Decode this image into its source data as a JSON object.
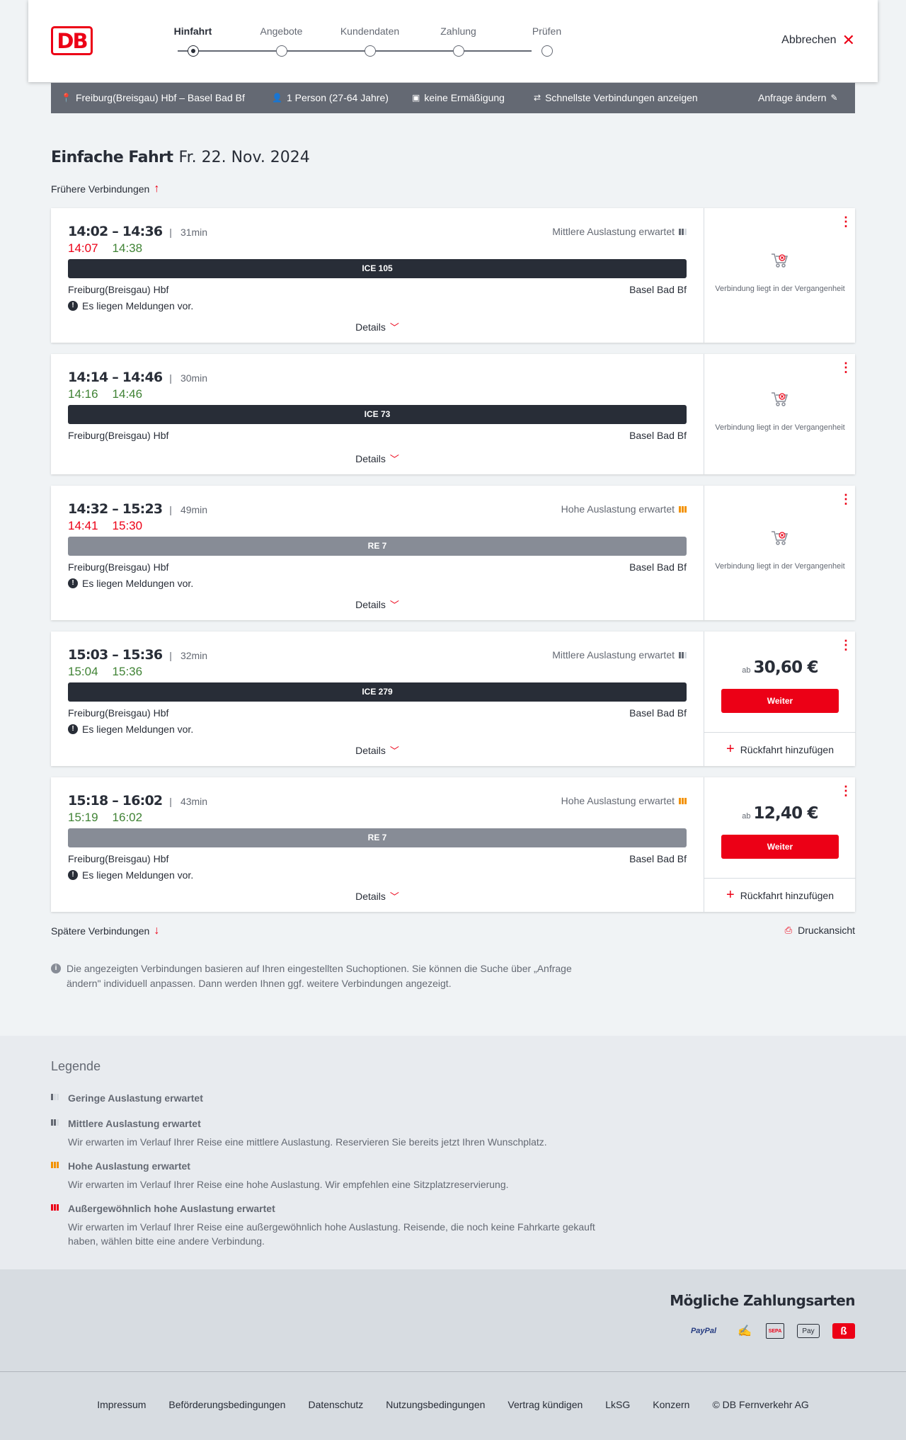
{
  "header": {
    "logo_text": "DB",
    "steps": [
      {
        "label": "Hinfahrt"
      },
      {
        "label": "Angebote"
      },
      {
        "label": "Kundendaten"
      },
      {
        "label": "Zahlung"
      },
      {
        "label": "Prüfen"
      }
    ],
    "cancel_label": "Abbrechen"
  },
  "searchbar": {
    "route": "Freiburg(Breisgau) Hbf – Basel Bad Bf",
    "persons": "1 Person (27-64 Jahre)",
    "discount": "keine Ermäßigung",
    "fastest": "Schnellste Verbindungen anzeigen",
    "change": "Anfrage ändern"
  },
  "title": {
    "main": "Einfache Fahrt",
    "date": "Fr. 22. Nov. 2024"
  },
  "earlier_label": "Frühere Verbindungen",
  "later_label": "Spätere Verbindungen",
  "print_label": "Druckansicht",
  "connections": [
    {
      "times": "14:02 – 14:36",
      "duration": "31min",
      "rt_dep": "14:07",
      "rt_arr": "14:38",
      "occupancy": "Mittlere Auslastung erwartet",
      "train": "ICE 105",
      "from": "Freiburg(Breisgau) Hbf",
      "to": "Basel Bad Bf",
      "message": "Es liegen Meldungen vor.",
      "details": "Details",
      "past": "Verbindung liegt in der Vergangenheit"
    },
    {
      "times": "14:14 – 14:46",
      "duration": "30min",
      "rt_dep": "14:16",
      "rt_arr": "14:46",
      "train": "ICE 73",
      "from": "Freiburg(Breisgau) Hbf",
      "to": "Basel Bad Bf",
      "details": "Details",
      "past": "Verbindung liegt in der Vergangenheit"
    },
    {
      "times": "14:32 – 15:23",
      "duration": "49min",
      "rt_dep": "14:41",
      "rt_arr": "15:30",
      "occupancy": "Hohe Auslastung erwartet",
      "train": "RE 7",
      "from": "Freiburg(Breisgau) Hbf",
      "to": "Basel Bad Bf",
      "message": "Es liegen Meldungen vor.",
      "details": "Details",
      "past": "Verbindung liegt in der Vergangenheit"
    },
    {
      "times": "15:03 – 15:36",
      "duration": "32min",
      "rt_dep": "15:04",
      "rt_arr": "15:36",
      "occupancy": "Mittlere Auslastung erwartet",
      "train": "ICE 279",
      "from": "Freiburg(Breisgau) Hbf",
      "to": "Basel Bad Bf",
      "message": "Es liegen Meldungen vor.",
      "details": "Details",
      "price_prefix": "ab",
      "price": "30,60 €",
      "weiter": "Weiter",
      "return": "Rückfahrt hinzufügen"
    },
    {
      "times": "15:18 – 16:02",
      "duration": "43min",
      "rt_dep": "15:19",
      "rt_arr": "16:02",
      "occupancy": "Hohe Auslastung erwartet",
      "train": "RE 7",
      "from": "Freiburg(Breisgau) Hbf",
      "to": "Basel Bad Bf",
      "message": "Es liegen Meldungen vor.",
      "details": "Details",
      "price_prefix": "ab",
      "price": "12,40 €",
      "weiter": "Weiter",
      "return": "Rückfahrt hinzufügen"
    }
  ],
  "info_text": "Die angezeigten Verbindungen basieren auf Ihren eingestellten Suchoptionen. Sie können die Suche über „Anfrage ändern\" individuell anpassen. Dann werden Ihnen ggf. weitere Verbindungen angezeigt.",
  "legend": {
    "title": "Legende",
    "items": [
      {
        "title": "Geringe Auslastung erwartet",
        "desc": ""
      },
      {
        "title": "Mittlere Auslastung erwartet",
        "desc": "Wir erwarten im Verlauf Ihrer Reise eine mittlere Auslastung. Reservieren Sie bereits jetzt Ihren Wunschplatz."
      },
      {
        "title": "Hohe Auslastung erwartet",
        "desc": "Wir erwarten im Verlauf Ihrer Reise eine hohe Auslastung. Wir empfehlen eine Sitzplatzreservierung."
      },
      {
        "title": "Außergewöhnlich hohe Auslastung erwartet",
        "desc": "Wir erwarten im Verlauf Ihrer Reise eine außergewöhnlich hohe Auslastung. Reisende, die noch keine Fahrkarte gekauft haben, wählen bitte eine andere Verbindung."
      }
    ]
  },
  "payments": {
    "title": "Mögliche Zahlungsarten",
    "paypal": "PayPal",
    "sepa": "SEPA",
    "applepay": "Pay"
  },
  "footer": [
    "Impressum",
    "Beförderungsbedingungen",
    "Datenschutz",
    "Nutzungsbedingungen",
    "Vertrag kündigen",
    "LkSG",
    "Konzern",
    "© DB Fernverkehr AG"
  ],
  "colors": {
    "brand_red": "#ec0016",
    "dark": "#282d37",
    "delay_red": "#ec0016",
    "ontime_green": "#408335",
    "occupancy_high": "#f39200"
  }
}
